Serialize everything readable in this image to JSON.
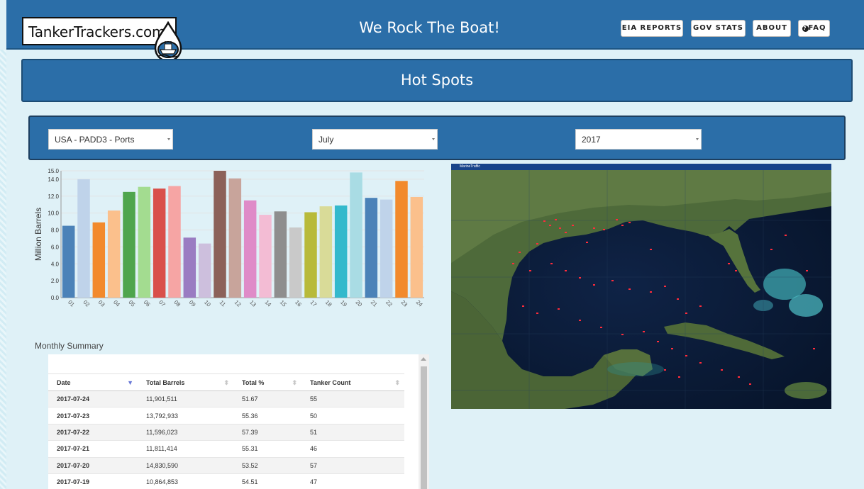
{
  "header": {
    "logo_text": "TankerTrackers.com",
    "site_title": "We Rock The Boat!",
    "nav": [
      {
        "label": "EIA REPORTS"
      },
      {
        "label": "GOV STATS"
      },
      {
        "label": "ABOUT"
      },
      {
        "label": "FAQ",
        "icon": "question-circle-icon"
      }
    ]
  },
  "hotspots": {
    "title": "Hot Spots"
  },
  "filters": {
    "region": "USA - PADD3 - Ports",
    "month": "July",
    "year": "2017"
  },
  "chart_data": {
    "type": "bar",
    "ylabel": "Million Barrels",
    "xlabel": "",
    "ylim": [
      0,
      15
    ],
    "y_ticks": [
      "0.0",
      "2.0",
      "4.0",
      "6.0",
      "8.0",
      "10.0",
      "12.0",
      "14.0",
      "15.0"
    ],
    "categories": [
      "01",
      "02",
      "03",
      "04",
      "05",
      "06",
      "07",
      "08",
      "09",
      "10",
      "11",
      "12",
      "13",
      "14",
      "15",
      "16",
      "17",
      "18",
      "19",
      "20",
      "21",
      "22",
      "23",
      "24"
    ],
    "values": [
      8.5,
      14.0,
      8.9,
      10.3,
      12.5,
      13.1,
      12.9,
      13.2,
      7.1,
      6.4,
      15.0,
      14.1,
      11.5,
      9.8,
      10.2,
      8.3,
      10.1,
      10.8,
      10.9,
      14.8,
      11.8,
      11.6,
      13.8,
      11.9
    ],
    "colors": [
      "#4b82b8",
      "#bfd3ea",
      "#f28a2c",
      "#fbc08c",
      "#4fa54d",
      "#a3dc90",
      "#d9504b",
      "#f6a5a4",
      "#9a7cc2",
      "#cdbfdd",
      "#8c6159",
      "#c8a49b",
      "#df8bc8",
      "#f3bcd4",
      "#8e8e8e",
      "#c9c9c9",
      "#b8ba3a",
      "#d9db98",
      "#34b9cc",
      "#a9dce4",
      "#4b82b8",
      "#bfd3ea",
      "#f28a2c",
      "#fbc08c"
    ]
  },
  "summary": {
    "title": "Monthly Summary",
    "columns": [
      "Date",
      "Total Barrels",
      "Total %",
      "Tanker Count"
    ],
    "rows": [
      [
        "2017-07-24",
        "11,901,511",
        "51.67",
        "55"
      ],
      [
        "2017-07-23",
        "13,792,933",
        "55.36",
        "50"
      ],
      [
        "2017-07-22",
        "11,596,023",
        "57.39",
        "51"
      ],
      [
        "2017-07-21",
        "11,811,414",
        "55.31",
        "46"
      ],
      [
        "2017-07-20",
        "14,830,590",
        "53.52",
        "57"
      ],
      [
        "2017-07-19",
        "10,864,853",
        "54.51",
        "47"
      ]
    ]
  },
  "map": {
    "provider": "MarineTraffic"
  }
}
